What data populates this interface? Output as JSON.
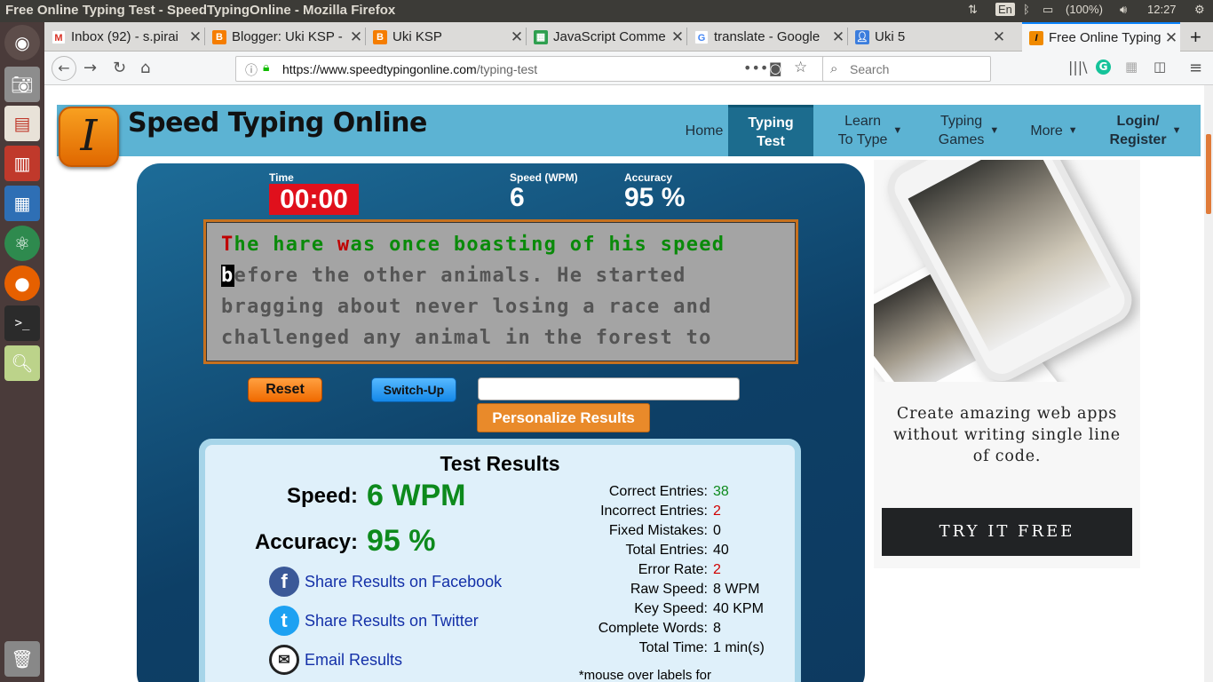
{
  "os": {
    "window_title": "Free Online Typing Test - SpeedTypingOnline - Mozilla Firefox",
    "keyboard_layout": "En",
    "battery": "(100%)",
    "clock": "12:27"
  },
  "browser": {
    "tabs": [
      {
        "label": "Inbox (92) - s.pirai",
        "favicon": "gmail-icon",
        "color": "#d93025"
      },
      {
        "label": "Blogger: Uki KSP -",
        "favicon": "blogger-icon",
        "color": "#f57d00"
      },
      {
        "label": "Uki KSP",
        "favicon": "blogger-icon",
        "color": "#f57d00"
      },
      {
        "label": "JavaScript Comme",
        "favicon": "sheet-icon",
        "color": "#2e9f4f"
      },
      {
        "label": "translate - Google",
        "favicon": "google-icon",
        "color": "#4285f4"
      },
      {
        "label": "Uki 5",
        "favicon": "person-icon",
        "color": "#3b7ddd"
      },
      {
        "label": "Free Online Typing",
        "favicon": "sto-icon",
        "color": "#f08a00"
      }
    ],
    "url_base": "https://www.speedtypingonline.com",
    "url_path": "/typing-test",
    "search_placeholder": "Search"
  },
  "site": {
    "logo_letter": "I",
    "name": "Speed Typing Online",
    "nav": [
      {
        "line1": "Home",
        "line2": ""
      },
      {
        "line1": "Typing",
        "line2": "Test"
      },
      {
        "line1": "Learn",
        "line2": "To Type"
      },
      {
        "line1": "Typing",
        "line2": "Games"
      },
      {
        "line1": "More",
        "line2": ""
      },
      {
        "line1": "Login/",
        "line2": "Register"
      }
    ]
  },
  "test": {
    "time_label": "Time",
    "time_value": "00:00",
    "speed_label": "Speed (WPM)",
    "speed_value": "6",
    "accuracy_label": "Accuracy",
    "accuracy_value": "95 %",
    "text_lines": [
      "The hare was once boasting of his speed",
      "before the other animals. He started",
      "bragging about never losing a race and",
      "challenged any animal in the forest to"
    ],
    "reset_label": "Reset",
    "switchup_label": "Switch-Up",
    "input_value": "",
    "personalize_label": "Personalize Results"
  },
  "results": {
    "title": "Test Results",
    "speed_label": "Speed:",
    "speed_value": "6 WPM",
    "accuracy_label": "Accuracy:",
    "accuracy_value": "95 %",
    "share_facebook": "Share Results on Facebook",
    "share_twitter": "Share Results on Twitter",
    "share_email": "Email Results",
    "stats": [
      {
        "label": "Correct Entries:",
        "value": "38",
        "color": "#0d8a1c"
      },
      {
        "label": "Incorrect Entries:",
        "value": "2",
        "color": "#d00000"
      },
      {
        "label": "Fixed Mistakes:",
        "value": "0",
        "color": "#000000"
      },
      {
        "label": "Total Entries:",
        "value": "40",
        "color": "#000000"
      },
      {
        "label": "Error Rate:",
        "value": "2",
        "color": "#d00000"
      },
      {
        "label": "Raw Speed:",
        "value": "8 WPM",
        "color": "#000000"
      },
      {
        "label": "Key Speed:",
        "value": "40 KPM",
        "color": "#000000"
      },
      {
        "label": "Complete Words:",
        "value": "8",
        "color": "#000000"
      },
      {
        "label": "Total Time:",
        "value": "1 min(s)",
        "color": "#000000"
      }
    ],
    "note": "*mouse over labels for more info"
  },
  "ad": {
    "text": "Create amazing web apps without writing single line of code.",
    "cta": "TRY IT FREE"
  },
  "colors": {
    "header_bg": "#5cb3d3",
    "active_nav": "#1c6c8e",
    "panel_bg": "#0d3f66",
    "correct": "#0a8a0a",
    "error": "#c00000"
  }
}
